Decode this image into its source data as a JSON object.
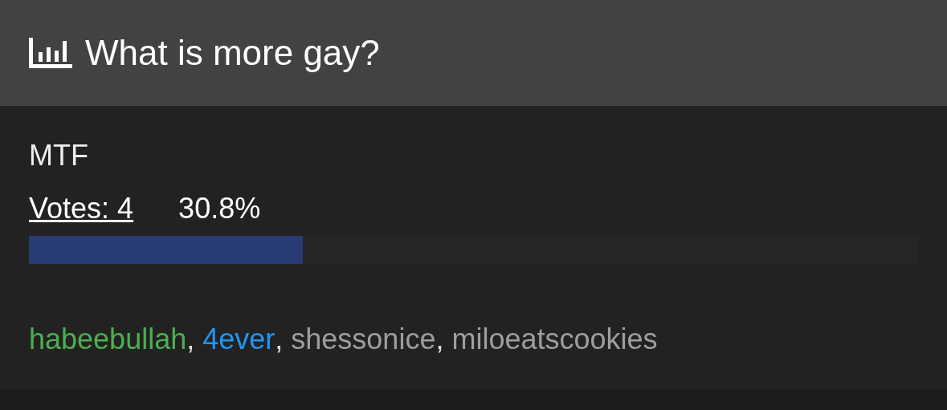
{
  "poll": {
    "title": "What is more gay?"
  },
  "option": {
    "label": "MTF",
    "votes": "Votes: 4",
    "percent": "30.8%",
    "level": 0.308
  },
  "voters_separator": ",",
  "voters": [
    {
      "name": "habeebullah",
      "color": "#4caf50"
    },
    {
      "name": "4ever",
      "color": "#2196f3"
    },
    {
      "name": "shessonice",
      "color": "#9e9e9e"
    },
    {
      "name": "miloeatscookies",
      "color": "#9e9e9e"
    }
  ]
}
